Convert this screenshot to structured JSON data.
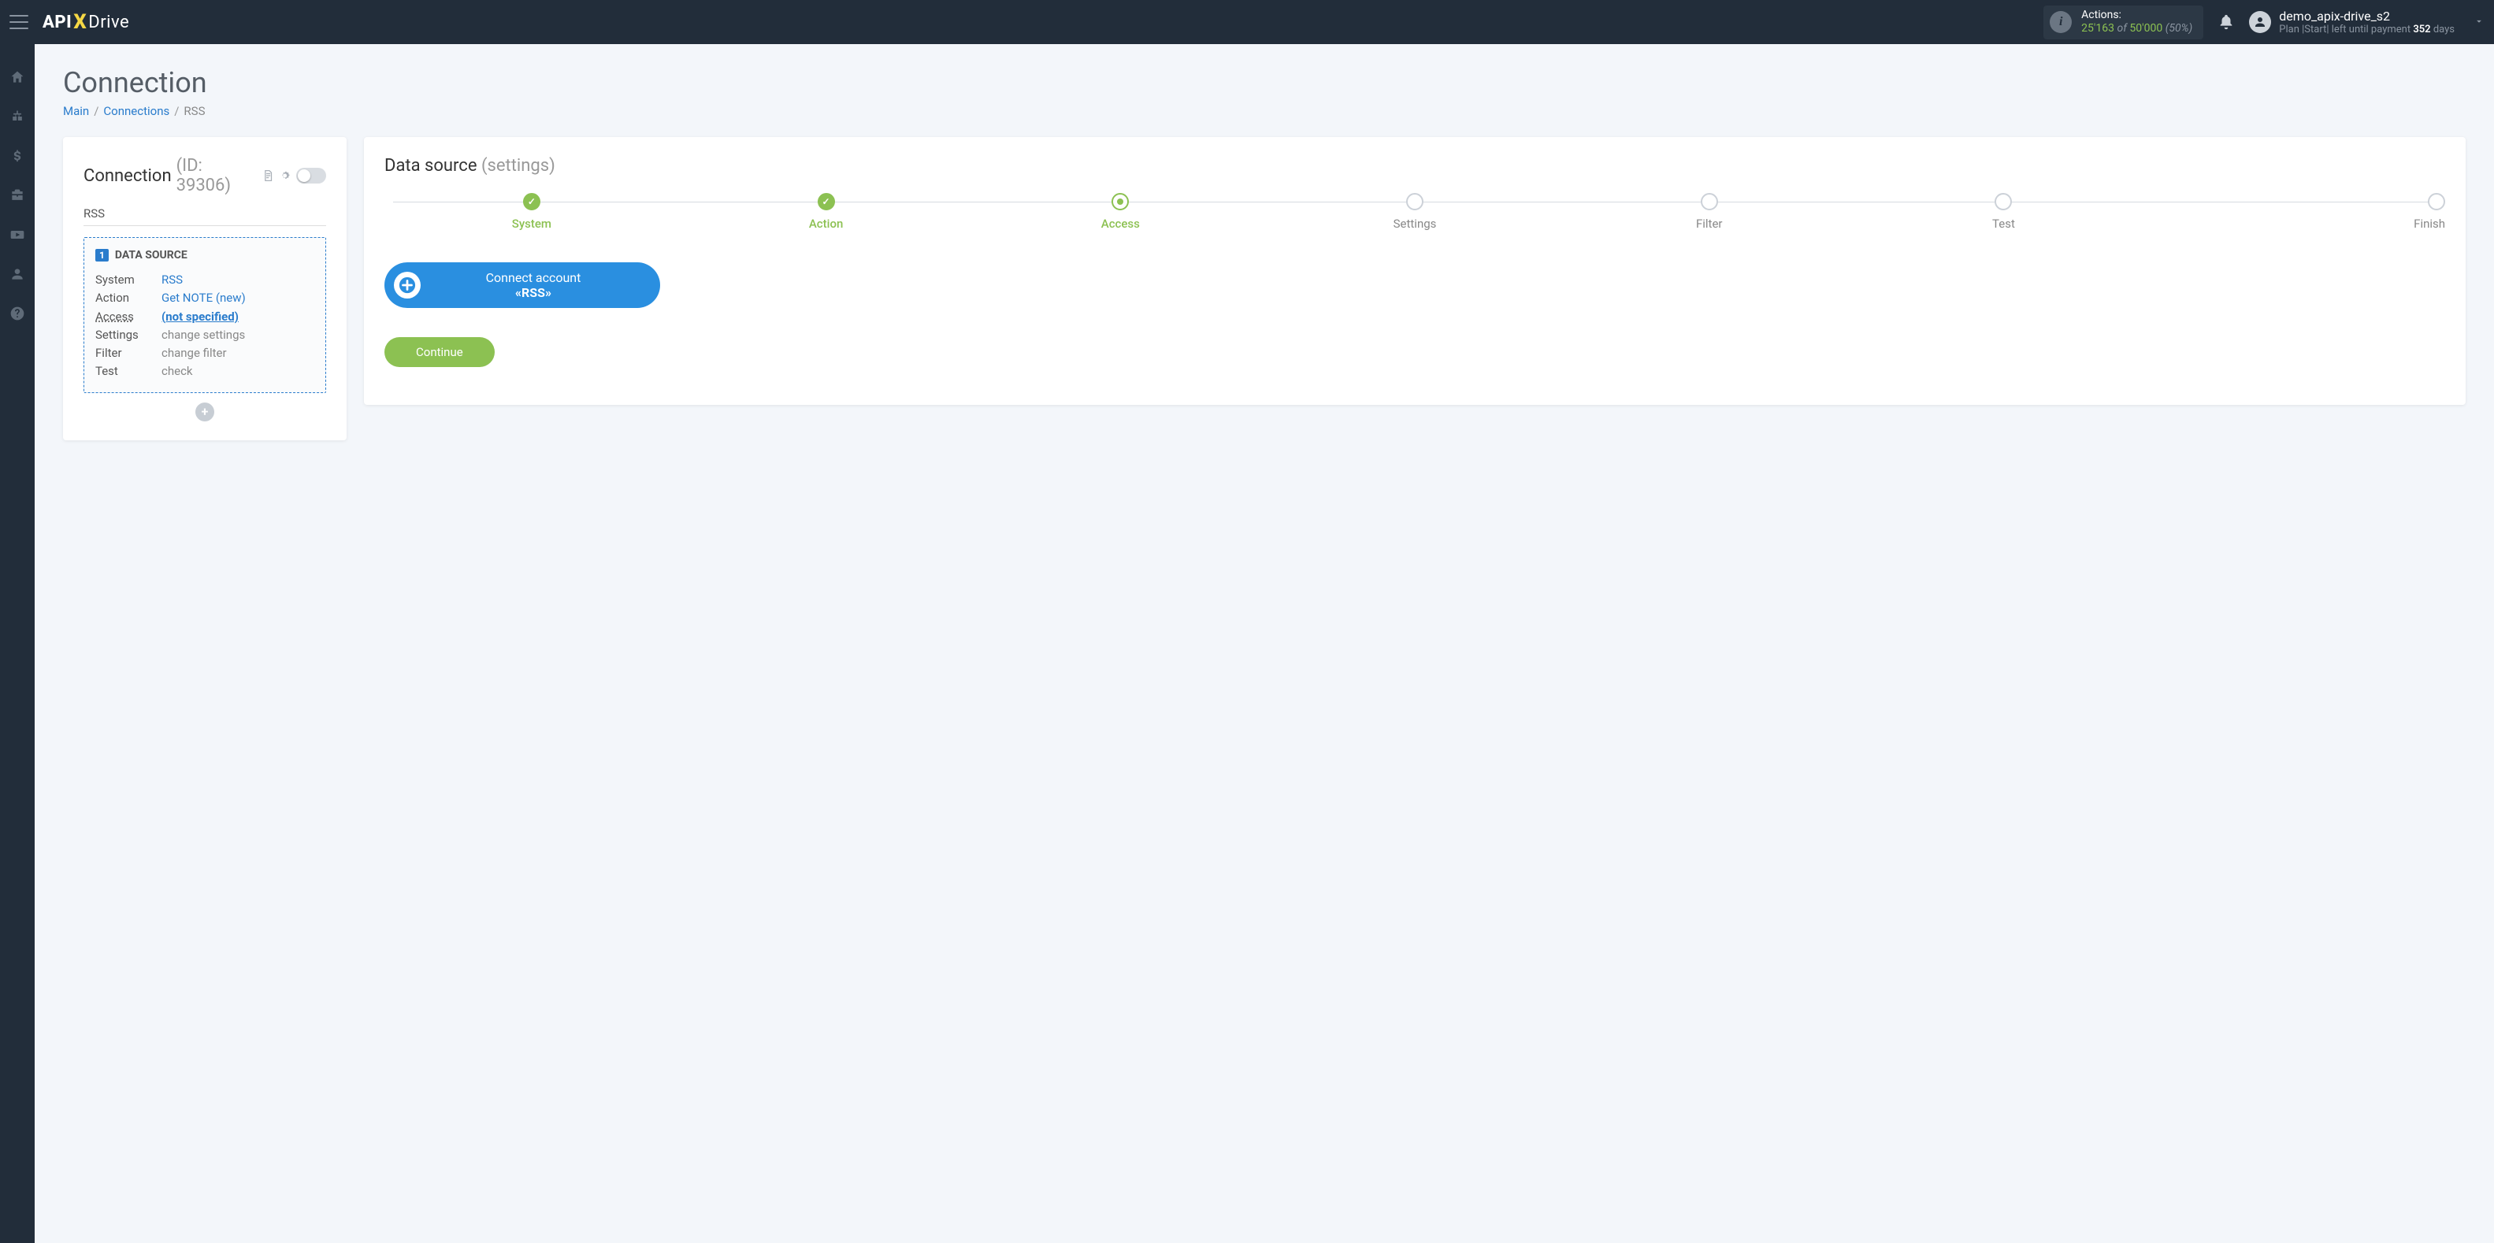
{
  "topbar": {
    "actions_label": "Actions:",
    "actions_used": "25'163",
    "actions_of": "of",
    "actions_total": "50'000",
    "actions_pct": "(50%)",
    "username": "demo_apix-drive_s2",
    "plan_prefix": "Plan |",
    "plan_name": "Start",
    "plan_mid": "| left until payment ",
    "plan_days": "352",
    "plan_suffix": " days"
  },
  "logo": {
    "p1": "API",
    "p2": "X",
    "p3": "Drive"
  },
  "page": {
    "title": "Connection",
    "bc_main": "Main",
    "bc_conn": "Connections",
    "bc_cur": "RSS"
  },
  "left": {
    "head": "Connection",
    "id": "(ID: 39306)",
    "rss": "RSS",
    "ds_badge": "1",
    "ds_title": "DATA SOURCE",
    "rows": {
      "system_k": "System",
      "system_v": "RSS",
      "action_k": "Action",
      "action_v": "Get NOTE (new)",
      "access_k": "Access",
      "access_v": "(not specified)",
      "settings_k": "Settings",
      "settings_v": "change settings",
      "filter_k": "Filter",
      "filter_v": "change filter",
      "test_k": "Test",
      "test_v": "check"
    }
  },
  "right": {
    "head": "Data source",
    "sub": "(settings)",
    "steps": {
      "system": "System",
      "action": "Action",
      "access": "Access",
      "settings": "Settings",
      "filter": "Filter",
      "test": "Test",
      "finish": "Finish"
    },
    "connect_l1": "Connect account",
    "connect_l2": "«RSS»",
    "continue": "Continue"
  }
}
